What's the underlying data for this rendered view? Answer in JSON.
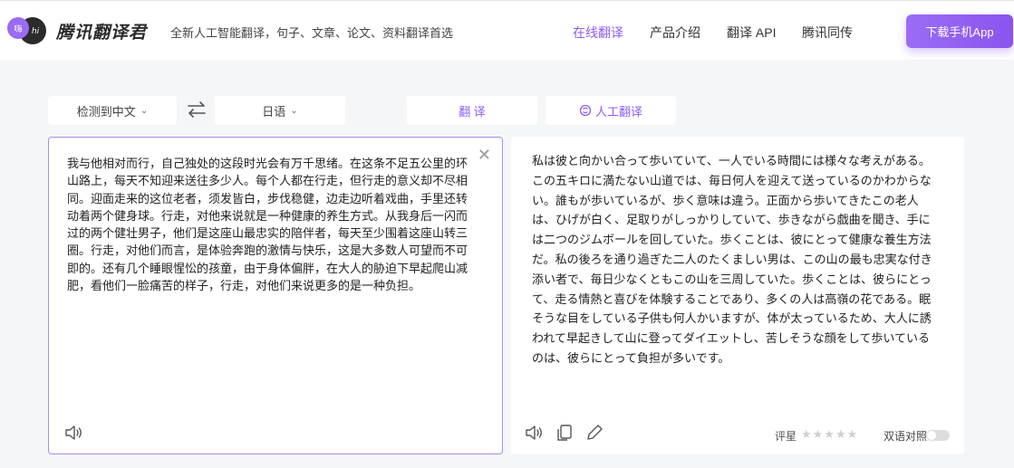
{
  "header": {
    "logo_badge": "嗨",
    "logo_text": "hi",
    "brand": "腾讯翻译君",
    "slogan": "全新人工智能翻译，句子、文章、论文、资料翻译首选",
    "nav": [
      {
        "label": "在线翻译",
        "active": true
      },
      {
        "label": "产品介绍",
        "active": false
      },
      {
        "label": "翻译 API",
        "active": false
      },
      {
        "label": "腾讯同传",
        "active": false
      }
    ],
    "download_label": "下载手机App"
  },
  "toolbar": {
    "source_lang": "检测到中文",
    "target_lang": "日语",
    "translate_label": "翻 译",
    "human_translate_label": "人工翻译"
  },
  "source": {
    "text": "我与他相对而行，自己独处的这段时光会有万千思绪。在这条不足五公里的环山路上，每天不知迎来送往多少人。每个人都在行走，但行走的意义却不尽相同。迎面走来的这位老者，须发皆白，步伐稳健，边走边听着戏曲，手里还转动着两个健身球。行走，对他来说就是一种健康的养生方式。从我身后一闪而过的两个健壮男子，他们是这座山最忠实的陪伴者，每天至少围着这座山转三圈。行走，对他们而言，是体验奔跑的激情与快乐，这是大多数人可望而不可即的。还有几个睡眼惺忪的孩童，由于身体偏胖，在大人的胁迫下早起爬山减肥，看他们一脸痛苦的样子，行走，对他们来说更多的是一种负担。"
  },
  "target": {
    "text": "私は彼と向かい合って歩いていて、一人でいる時間には様々な考えがある。この五キロに満たない山道では、毎日何人を迎えて送っているのかわからない。誰もが歩いているが、歩く意味は違う。正面から歩いてきたこの老人は、ひげが白く、足取りがしっかりしていて、歩きながら戯曲を聞き、手には二つのジムボールを回していた。歩くことは、彼にとって健康な養生方法だ。私の後ろを通り過ぎた二人のたくましい男は、この山の最も忠実な付き添い者で、毎日少なくともこの山を三周していた。歩くことは、彼らにとって、走る情熱と喜びを体験することであり、多くの人は高嶺の花である。眠そうな目をしている子供も何人かいますが、体が太っているため、大人に誘われて早起きして山に登ってダイエットし、苦しそうな顔をして歩いているのは、彼らにとって負担が多いです。",
    "rating_label": "评星",
    "stars": "★★★★★",
    "bilingual_label": "双语对照"
  },
  "colors": {
    "accent": "#8b5cf6",
    "panel_border": "#a98be8",
    "background": "#f5f6f8"
  }
}
